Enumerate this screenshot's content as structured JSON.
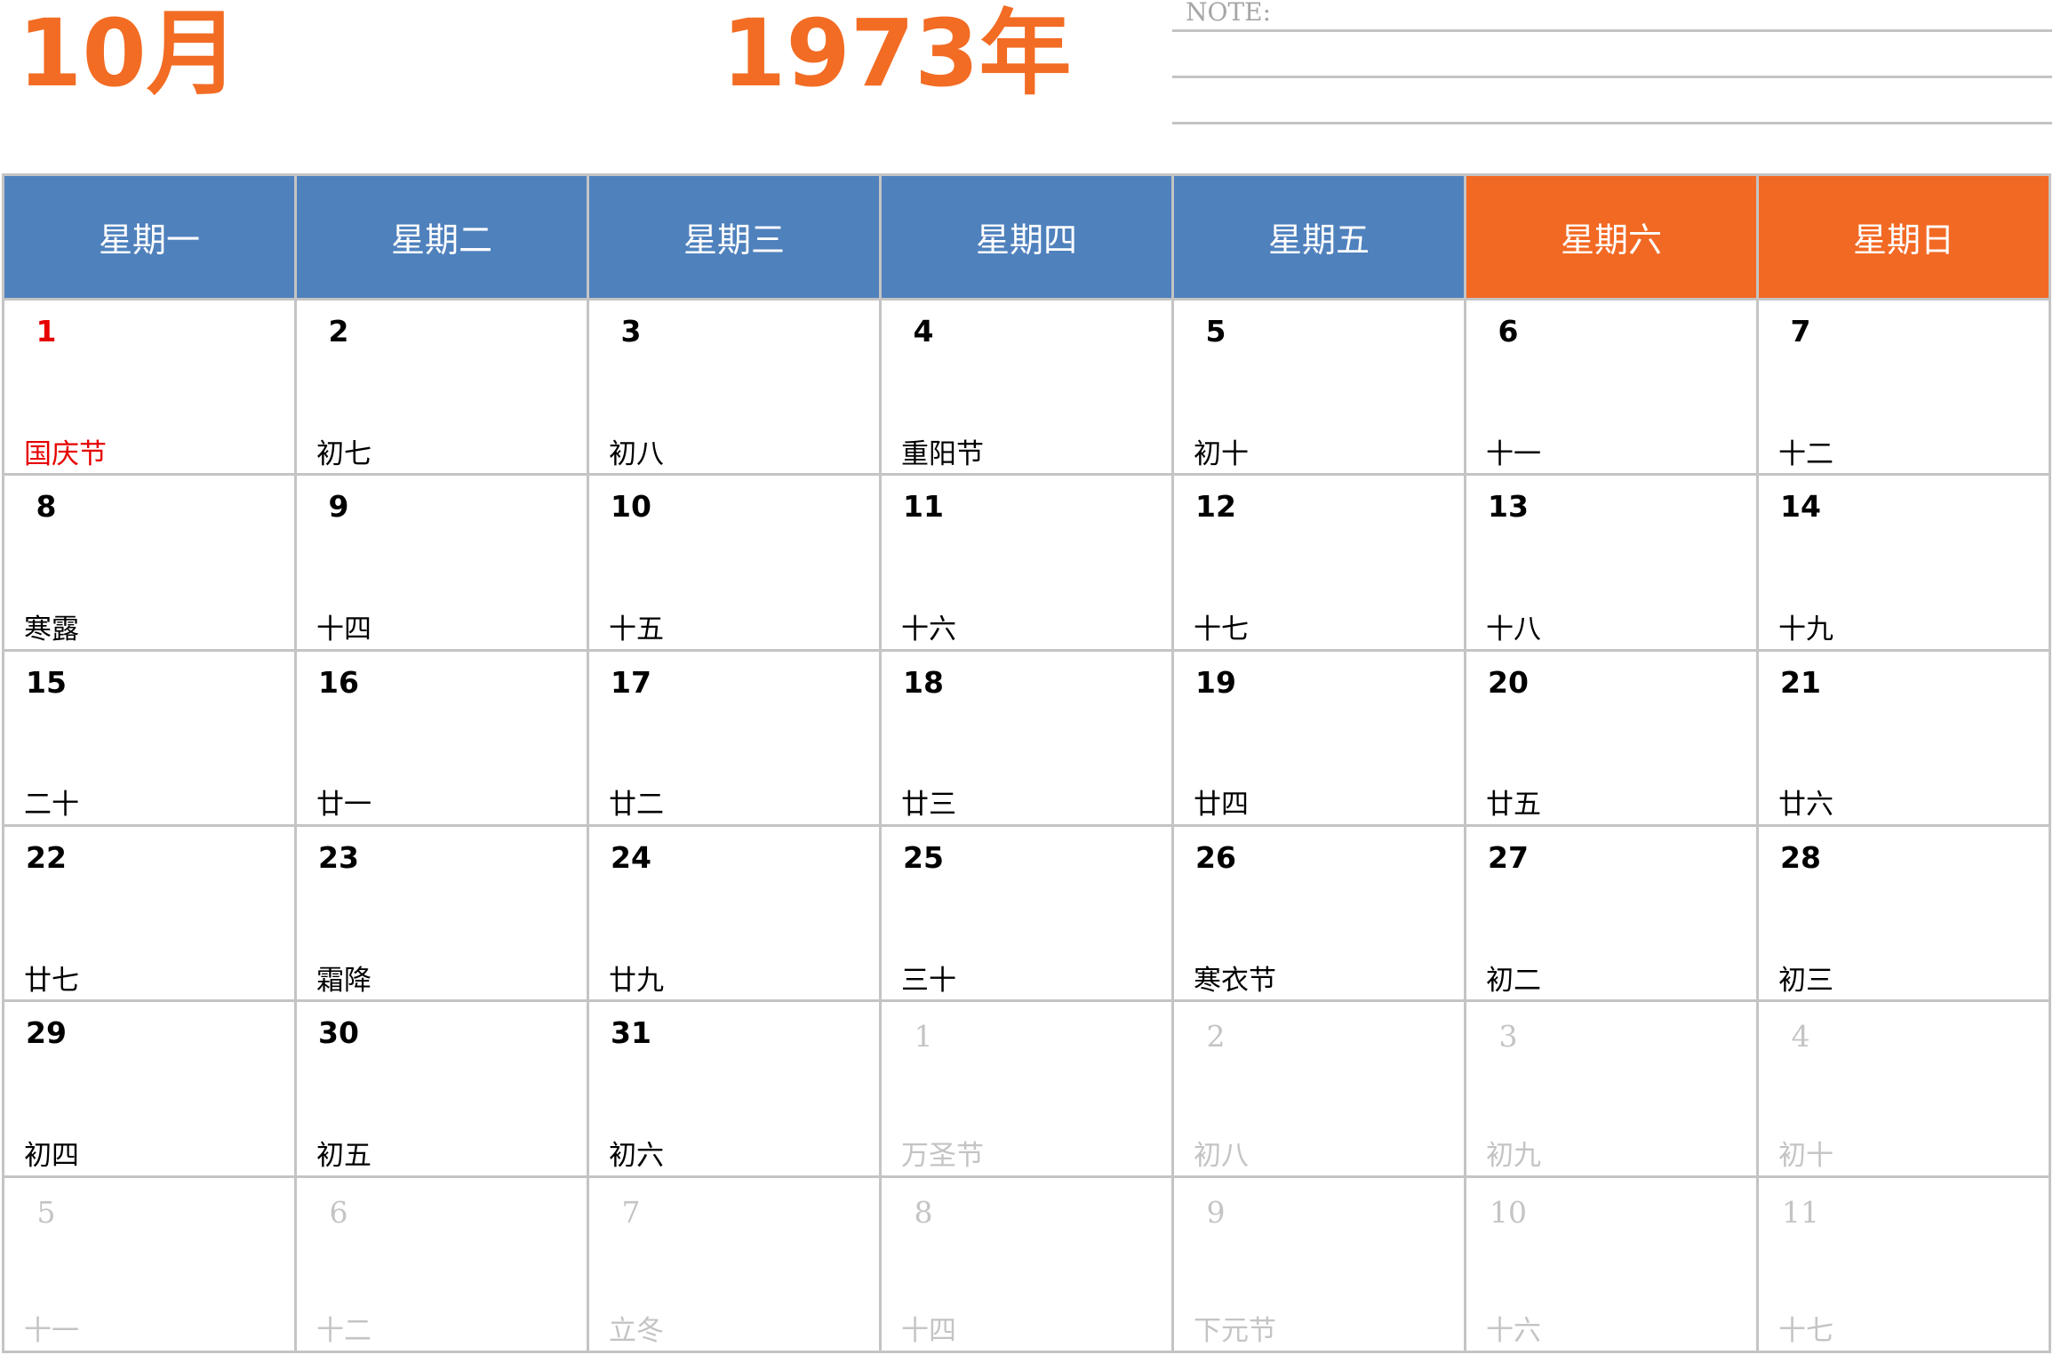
{
  "header": {
    "month": "10月",
    "year": "1973年",
    "note_label": "NOTE:"
  },
  "colors": {
    "accent": "#f26c24",
    "weekday_header": "#4f81bd",
    "weekend_header": "#f26924",
    "holiday_text": "#e60000",
    "muted_text": "#c4c4c4",
    "grid_line": "#c4c4c4"
  },
  "weekdays": [
    {
      "label": "星期一",
      "weekend": false
    },
    {
      "label": "星期二",
      "weekend": false
    },
    {
      "label": "星期三",
      "weekend": false
    },
    {
      "label": "星期四",
      "weekend": false
    },
    {
      "label": "星期五",
      "weekend": false
    },
    {
      "label": "星期六",
      "weekend": true
    },
    {
      "label": "星期日",
      "weekend": true
    }
  ],
  "weeks": [
    [
      {
        "day": "1",
        "lunar": "国庆节",
        "holiday": true
      },
      {
        "day": "2",
        "lunar": "初七"
      },
      {
        "day": "3",
        "lunar": "初八"
      },
      {
        "day": "4",
        "lunar": "重阳节"
      },
      {
        "day": "5",
        "lunar": "初十"
      },
      {
        "day": "6",
        "lunar": "十一"
      },
      {
        "day": "7",
        "lunar": "十二"
      }
    ],
    [
      {
        "day": "8",
        "lunar": "寒露"
      },
      {
        "day": "9",
        "lunar": "十四"
      },
      {
        "day": "10",
        "lunar": "十五"
      },
      {
        "day": "11",
        "lunar": "十六"
      },
      {
        "day": "12",
        "lunar": "十七"
      },
      {
        "day": "13",
        "lunar": "十八"
      },
      {
        "day": "14",
        "lunar": "十九"
      }
    ],
    [
      {
        "day": "15",
        "lunar": "二十"
      },
      {
        "day": "16",
        "lunar": "廿一"
      },
      {
        "day": "17",
        "lunar": "廿二"
      },
      {
        "day": "18",
        "lunar": "廿三"
      },
      {
        "day": "19",
        "lunar": "廿四"
      },
      {
        "day": "20",
        "lunar": "廿五"
      },
      {
        "day": "21",
        "lunar": "廿六"
      }
    ],
    [
      {
        "day": "22",
        "lunar": "廿七"
      },
      {
        "day": "23",
        "lunar": "霜降"
      },
      {
        "day": "24",
        "lunar": "廿九"
      },
      {
        "day": "25",
        "lunar": "三十"
      },
      {
        "day": "26",
        "lunar": "寒衣节"
      },
      {
        "day": "27",
        "lunar": "初二"
      },
      {
        "day": "28",
        "lunar": "初三"
      }
    ],
    [
      {
        "day": "29",
        "lunar": "初四"
      },
      {
        "day": "30",
        "lunar": "初五"
      },
      {
        "day": "31",
        "lunar": "初六"
      },
      {
        "day": "1",
        "lunar": "万圣节",
        "muted": true
      },
      {
        "day": "2",
        "lunar": "初八",
        "muted": true
      },
      {
        "day": "3",
        "lunar": "初九",
        "muted": true
      },
      {
        "day": "4",
        "lunar": "初十",
        "muted": true
      }
    ],
    [
      {
        "day": "5",
        "lunar": "十一",
        "muted": true
      },
      {
        "day": "6",
        "lunar": "十二",
        "muted": true
      },
      {
        "day": "7",
        "lunar": "立冬",
        "muted": true
      },
      {
        "day": "8",
        "lunar": "十四",
        "muted": true
      },
      {
        "day": "9",
        "lunar": "下元节",
        "muted": true
      },
      {
        "day": "10",
        "lunar": "十六",
        "muted": true
      },
      {
        "day": "11",
        "lunar": "十七",
        "muted": true
      }
    ]
  ]
}
